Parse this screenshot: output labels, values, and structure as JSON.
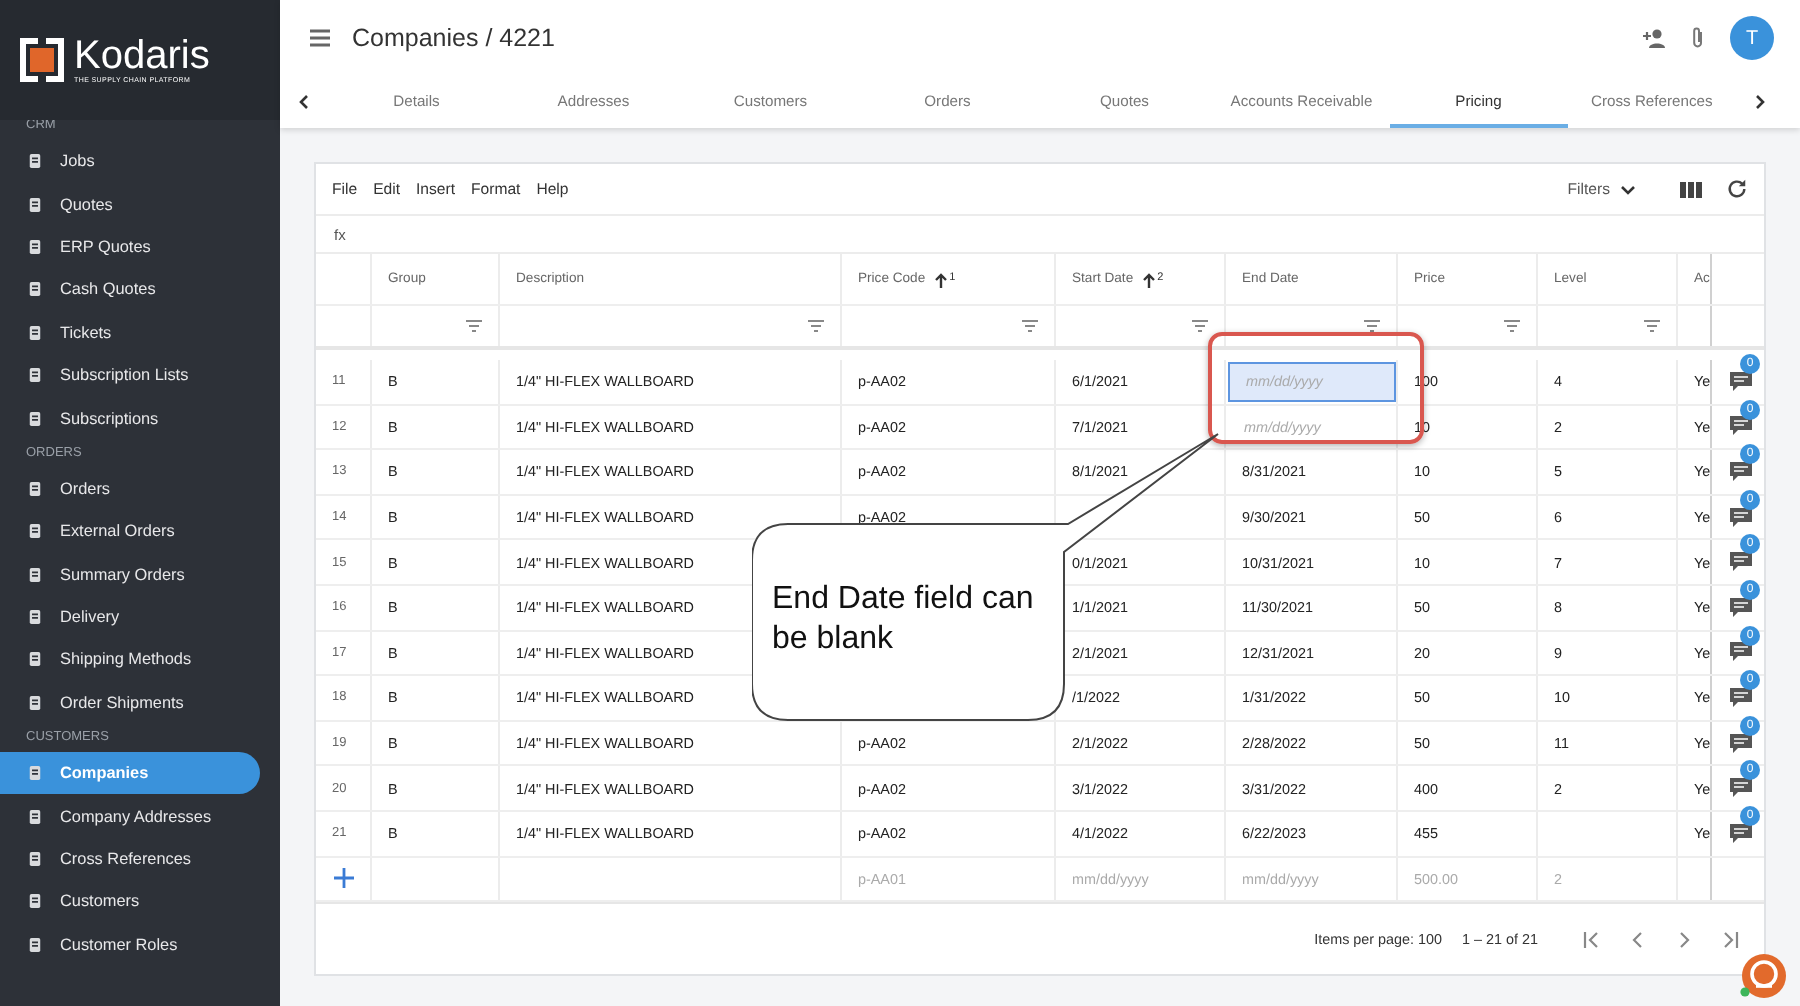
{
  "sidebar": {
    "logo": {
      "name": "Kodaris",
      "tagline": "THE SUPPLY CHAIN PLATFORM"
    },
    "sections": [
      {
        "title": "CRM",
        "items": [
          {
            "label": "Jobs",
            "selected": false
          },
          {
            "label": "Quotes",
            "selected": false
          },
          {
            "label": "ERP Quotes",
            "selected": false
          },
          {
            "label": "Cash Quotes",
            "selected": false
          },
          {
            "label": "Tickets",
            "selected": false
          },
          {
            "label": "Subscription Lists",
            "selected": false
          },
          {
            "label": "Subscriptions",
            "selected": false
          }
        ]
      },
      {
        "title": "ORDERS",
        "items": [
          {
            "label": "Orders",
            "selected": false
          },
          {
            "label": "External Orders",
            "selected": false
          },
          {
            "label": "Summary Orders",
            "selected": false
          },
          {
            "label": "Delivery",
            "selected": false
          },
          {
            "label": "Shipping Methods",
            "selected": false
          },
          {
            "label": "Order Shipments",
            "selected": false
          }
        ]
      },
      {
        "title": "CUSTOMERS",
        "items": [
          {
            "label": "Companies",
            "selected": true
          },
          {
            "label": "Company Addresses",
            "selected": false
          },
          {
            "label": "Cross References",
            "selected": false
          },
          {
            "label": "Customers",
            "selected": false
          },
          {
            "label": "Customer Roles",
            "selected": false
          }
        ]
      }
    ]
  },
  "header": {
    "title": "Companies / 4221",
    "avatar": "T"
  },
  "tabs": [
    {
      "label": "Details",
      "selected": false
    },
    {
      "label": "Addresses",
      "selected": false
    },
    {
      "label": "Customers",
      "selected": false
    },
    {
      "label": "Orders",
      "selected": false
    },
    {
      "label": "Quotes",
      "selected": false
    },
    {
      "label": "Accounts Receivable",
      "selected": false
    },
    {
      "label": "Pricing",
      "selected": true
    },
    {
      "label": "Cross References",
      "selected": false
    }
  ],
  "grid": {
    "menu": [
      "File",
      "Edit",
      "Insert",
      "Format",
      "Help"
    ],
    "filters_label": "Filters",
    "formula_label": "fx",
    "columns": [
      {
        "label": "Group"
      },
      {
        "label": "Description"
      },
      {
        "label": "Price Code",
        "sort": "1"
      },
      {
        "label": "Start Date",
        "sort": "2"
      },
      {
        "label": "End Date"
      },
      {
        "label": "Price"
      },
      {
        "label": "Level"
      },
      {
        "label": "Ac"
      }
    ],
    "rows": [
      {
        "num": "11",
        "group": "B",
        "description": "1/4\" HI-FLEX WALLBOARD",
        "price_code": "p-AA02",
        "start_date": "6/1/2021",
        "end_date_placeholder": "mm/dd/yyyy",
        "end_date_focused": true,
        "price": "100",
        "level": "4",
        "active": "Ye",
        "comments": "0"
      },
      {
        "num": "12",
        "group": "B",
        "description": "1/4\" HI-FLEX WALLBOARD",
        "price_code": "p-AA02",
        "start_date": "7/1/2021",
        "end_date_placeholder": "mm/dd/yyyy",
        "end_date_focused": false,
        "price": "10",
        "level": "2",
        "active": "Ye",
        "comments": "0"
      },
      {
        "num": "13",
        "group": "B",
        "description": "1/4\" HI-FLEX WALLBOARD",
        "price_code": "p-AA02",
        "start_date": "8/1/2021",
        "end_date": "8/31/2021",
        "price": "10",
        "level": "5",
        "active": "Ye",
        "comments": "0"
      },
      {
        "num": "14",
        "group": "B",
        "description": "1/4\" HI-FLEX WALLBOARD",
        "price_code": "p-AA02",
        "end_date": "9/30/2021",
        "price": "50",
        "level": "6",
        "active": "Ye",
        "comments": "0"
      },
      {
        "num": "15",
        "group": "B",
        "description": "1/4\" HI-FLEX WALLBOARD",
        "start_date": "0/1/2021",
        "end_date": "10/31/2021",
        "price": "10",
        "level": "7",
        "active": "Ye",
        "comments": "0"
      },
      {
        "num": "16",
        "group": "B",
        "description": "1/4\" HI-FLEX WALLBOARD",
        "start_date": "1/1/2021",
        "end_date": "11/30/2021",
        "price": "50",
        "level": "8",
        "active": "Ye",
        "comments": "0"
      },
      {
        "num": "17",
        "group": "B",
        "description": "1/4\" HI-FLEX WALLBOARD",
        "start_date": "2/1/2021",
        "end_date": "12/31/2021",
        "price": "20",
        "level": "9",
        "active": "Ye",
        "comments": "0"
      },
      {
        "num": "18",
        "group": "B",
        "description": "1/4\" HI-FLEX WALLBOARD",
        "start_date": "/1/2022",
        "end_date": "1/31/2022",
        "price": "50",
        "level": "10",
        "active": "Ye",
        "comments": "0"
      },
      {
        "num": "19",
        "group": "B",
        "description": "1/4\" HI-FLEX WALLBOARD",
        "price_code": "p-AA02",
        "start_date": "2/1/2022",
        "end_date": "2/28/2022",
        "price": "50",
        "level": "11",
        "active": "Ye",
        "comments": "0"
      },
      {
        "num": "20",
        "group": "B",
        "description": "1/4\" HI-FLEX WALLBOARD",
        "price_code": "p-AA02",
        "start_date": "3/1/2022",
        "end_date": "3/31/2022",
        "price": "400",
        "level": "2",
        "active": "Ye",
        "comments": "0"
      },
      {
        "num": "21",
        "group": "B",
        "description": "1/4\" HI-FLEX WALLBOARD",
        "price_code": "p-AA02",
        "start_date": "4/1/2022",
        "end_date": "6/22/2023",
        "price": "455",
        "active": "Ye",
        "comments": "0"
      }
    ],
    "new_row": {
      "price_code": "p-AA01",
      "start_date": "mm/dd/yyyy",
      "end_date": "mm/dd/yyyy",
      "price": "500.00",
      "level": "2"
    },
    "footer": {
      "items_per_page": "Items per page: 100",
      "range": "1 – 21 of 21"
    }
  },
  "callout": {
    "text": "End Date field can be blank"
  }
}
